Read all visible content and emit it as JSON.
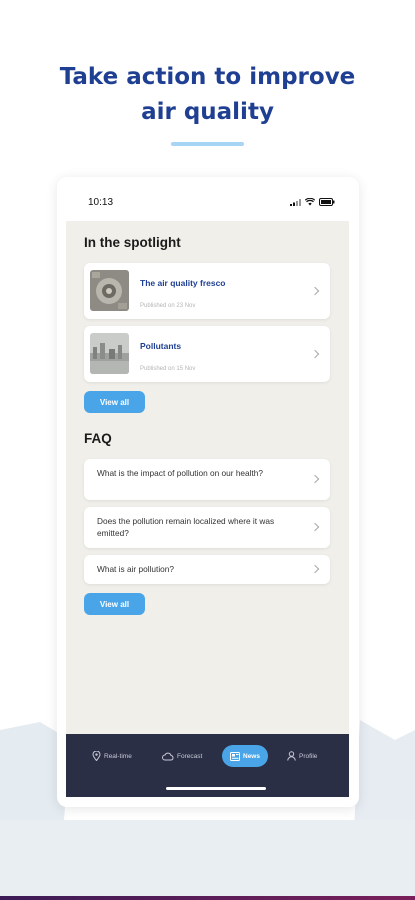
{
  "headline": {
    "line1": "Take action to improve",
    "line2": "air quality"
  },
  "status_bar": {
    "time": "10:13"
  },
  "spotlight": {
    "title": "In the spotlight",
    "items": [
      {
        "title": "The air quality fresco",
        "date": "Published on 23 Nov",
        "thumb_icon": "aerial-city-image"
      },
      {
        "title": "Pollutants",
        "date": "Published on 15 Nov",
        "thumb_icon": "city-skyline-image"
      }
    ],
    "view_all_label": "View all"
  },
  "faq": {
    "title": "FAQ",
    "items": [
      {
        "question": "What is the impact of pollution on our health?"
      },
      {
        "question": "Does the pollution remain localized where it was emitted?"
      },
      {
        "question": "What is air pollution?"
      }
    ],
    "view_all_label": "View all"
  },
  "tabbar": {
    "tabs": [
      {
        "label": "Real-time",
        "icon": "location-pin-icon"
      },
      {
        "label": "Forecast",
        "icon": "cloud-icon"
      },
      {
        "label": "News",
        "icon": "newspaper-icon",
        "active": true
      },
      {
        "label": "Profile",
        "icon": "person-icon"
      }
    ]
  },
  "colors": {
    "brand_blue": "#1f3f93",
    "accent": "#4aa5e8",
    "tabbar_bg": "#2b2f45",
    "screen_bg": "#f1efea"
  }
}
